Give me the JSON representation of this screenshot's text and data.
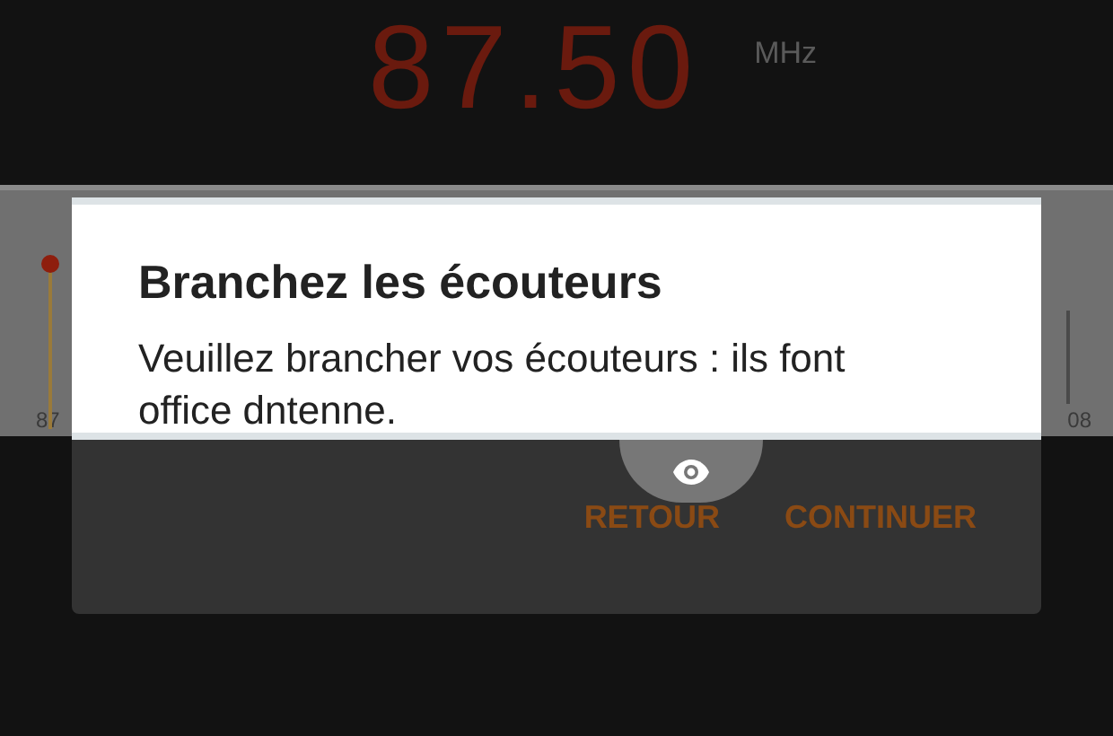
{
  "radio": {
    "frequency": "87.50",
    "unit": "MHz"
  },
  "tuner": {
    "start_label": "87",
    "end_label": "08"
  },
  "dialog": {
    "title": "Branchez les écouteurs",
    "message": "Veuillez brancher vos écouteurs : ils font office dntenne.",
    "buttons": [
      {
        "label": "RETOUR"
      },
      {
        "label": "CONTINUER"
      }
    ]
  }
}
